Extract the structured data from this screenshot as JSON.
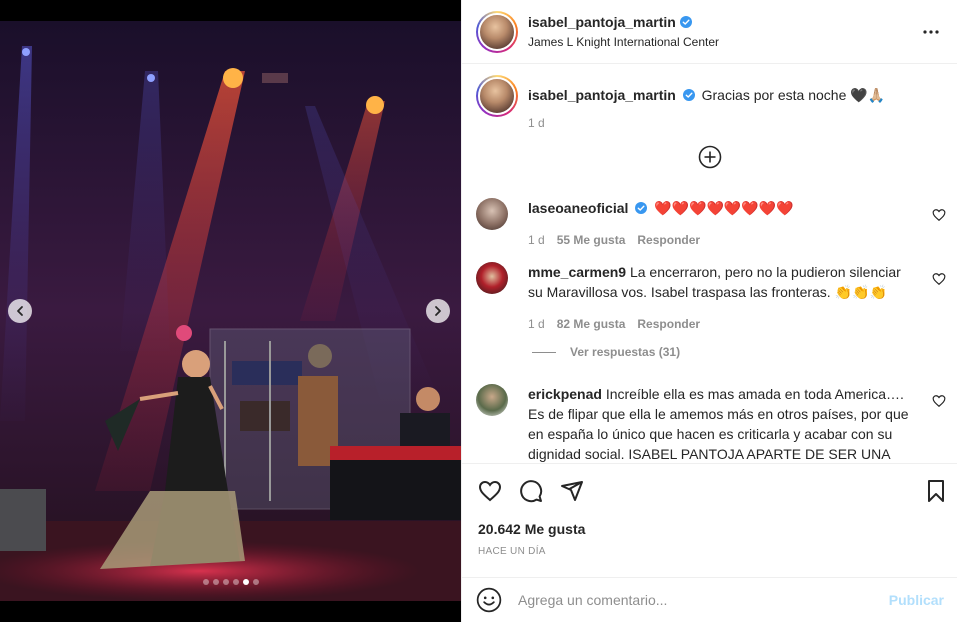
{
  "post": {
    "username": "isabel_pantoja_martin",
    "location": "James L Knight International Center",
    "caption": "Gracias por esta noche 🖤🙏🏼",
    "caption_age": "1 d",
    "likes": "20.642 Me gusta",
    "time_ago": "HACE UN DÍA"
  },
  "comments": [
    {
      "username": "laseoaneoficial",
      "verified": true,
      "text": "❤️❤️❤️❤️❤️❤️❤️❤️",
      "age": "1 d",
      "likes": "55 Me gusta",
      "reply": "Responder"
    },
    {
      "username": "mme_carmen9",
      "verified": false,
      "text": "La encerraron, pero no la pudieron silenciar su Maravillosa vos. Isabel traspasa las fronteras. 👏👏👏",
      "age": "1 d",
      "likes": "82 Me gusta",
      "reply": "Responder",
      "view_replies": "Ver respuestas (31)"
    },
    {
      "username": "erickpenad",
      "verified": false,
      "text": "Increíble ella es mas amada en toda America…. Es de flipar que ella le amemos más en otros países, por que en españa lo único que hacen es criticarla y acabar con su dignidad social. ISABEL PANTOJA APARTE DE SER UNA"
    }
  ],
  "composer": {
    "placeholder": "Agrega un comentario...",
    "post_label": "Publicar"
  },
  "carousel": {
    "count": 6,
    "active_index": 4
  },
  "icons": {
    "verified": "verified-badge-icon",
    "more": "more-options-icon",
    "add": "add-circle-icon",
    "like": "heart-icon",
    "comment": "comment-icon",
    "share": "share-icon",
    "save": "bookmark-icon",
    "emoji": "emoji-icon",
    "prev": "chevron-left-icon",
    "next": "chevron-right-icon"
  },
  "colors": {
    "verified": "#3897f0",
    "publish_disabled": "#b2dffc",
    "muted": "#8e8e8e",
    "text": "#262626"
  }
}
